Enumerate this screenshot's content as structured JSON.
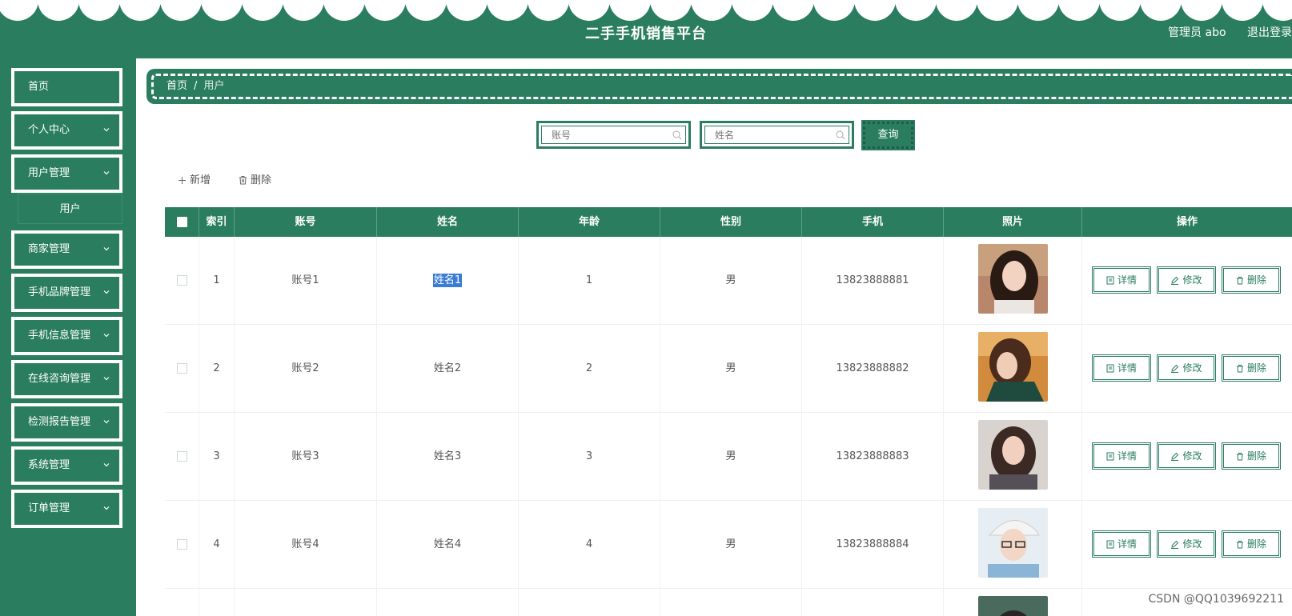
{
  "header": {
    "title": "二手手机销售平台",
    "user_label": "管理员 abo",
    "logout_label": "退出登录"
  },
  "sidebar": {
    "items": [
      {
        "label": "首页",
        "has_chevron": false
      },
      {
        "label": "个人中心",
        "has_chevron": true
      },
      {
        "label": "用户管理",
        "has_chevron": true
      },
      {
        "label": "商家管理",
        "has_chevron": true
      },
      {
        "label": "手机品牌管理",
        "has_chevron": true
      },
      {
        "label": "手机信息管理",
        "has_chevron": true
      },
      {
        "label": "在线咨询管理",
        "has_chevron": true
      },
      {
        "label": "检测报告管理",
        "has_chevron": true
      },
      {
        "label": "系统管理",
        "has_chevron": true
      },
      {
        "label": "订单管理",
        "has_chevron": true
      }
    ],
    "submenu": {
      "label": "用户",
      "parent": "用户管理"
    }
  },
  "breadcrumb": {
    "home": "首页",
    "separator": "/",
    "current": "用户"
  },
  "search": {
    "account_placeholder": "账号",
    "name_placeholder": "姓名",
    "query_label": "查询"
  },
  "actions": {
    "add_label": "新增",
    "delete_label": "删除"
  },
  "table": {
    "columns": [
      "索引",
      "账号",
      "姓名",
      "年龄",
      "性别",
      "手机",
      "照片",
      "操作"
    ],
    "rows": [
      {
        "index": "1",
        "account": "账号1",
        "name": "姓名1",
        "age": "1",
        "gender": "男",
        "phone": "13823888881",
        "name_selected": true
      },
      {
        "index": "2",
        "account": "账号2",
        "name": "姓名2",
        "age": "2",
        "gender": "男",
        "phone": "13823888882",
        "name_selected": false
      },
      {
        "index": "3",
        "account": "账号3",
        "name": "姓名3",
        "age": "3",
        "gender": "男",
        "phone": "13823888883",
        "name_selected": false
      },
      {
        "index": "4",
        "account": "账号4",
        "name": "姓名4",
        "age": "4",
        "gender": "男",
        "phone": "13823888884",
        "name_selected": false
      }
    ],
    "row_buttons": {
      "detail": "详情",
      "edit": "修改",
      "delete": "删除"
    }
  },
  "watermark": "CSDN @QQ1039692211",
  "colors": {
    "primary": "#2a7d5f",
    "selection": "#3a7bd5"
  }
}
